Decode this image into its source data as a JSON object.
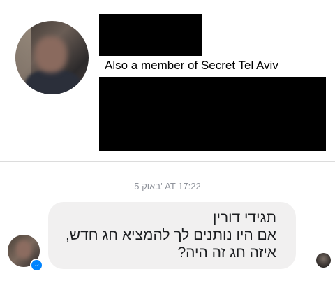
{
  "profile": {
    "member_text": "Also a member of Secret Tel Aviv"
  },
  "conversation": {
    "timestamp": "5 באוק' AT 17:22",
    "message": {
      "lines": [
        "תגידי דורין",
        "אם היו נותנים לך להמציא חג חדש,",
        "איזה חג זה היה?"
      ]
    }
  },
  "icons": {
    "messenger_badge": "messenger-icon"
  },
  "colors": {
    "messenger_blue": "#0084ff",
    "bubble_bg": "#f1f0f0",
    "timestamp_gray": "#90949c"
  }
}
